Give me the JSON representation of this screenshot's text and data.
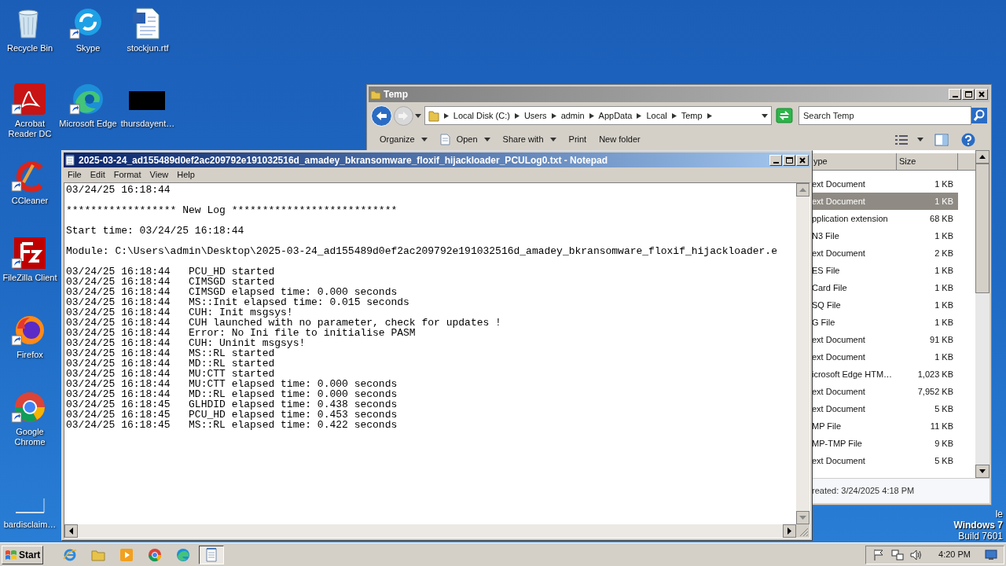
{
  "desktop_icons": [
    {
      "label": "Recycle Bin",
      "kind": "bin",
      "shortcut": false
    },
    {
      "label": "Skype",
      "kind": "skype",
      "shortcut": true
    },
    {
      "label": "stockjun.rtf",
      "kind": "doc",
      "shortcut": false
    },
    {
      "label": "Acrobat Reader DC",
      "kind": "acrobat",
      "shortcut": true
    },
    {
      "label": "Microsoft Edge",
      "kind": "edge",
      "shortcut": true
    },
    {
      "label": "thursdayent…",
      "kind": "blank_black",
      "shortcut": false
    },
    {
      "label": "CCleaner",
      "kind": "ccleaner",
      "shortcut": true
    },
    {
      "label": "FileZilla Client",
      "kind": "filezilla",
      "shortcut": true
    },
    {
      "label": "Firefox",
      "kind": "firefox",
      "shortcut": true
    },
    {
      "label": "Google Chrome",
      "kind": "chrome",
      "shortcut": true
    },
    {
      "label": "bardisclaim…",
      "kind": "blank_white",
      "shortcut": false
    }
  ],
  "os_branding": {
    "line_1": "le",
    "line_2": "Windows 7",
    "line_3": "Build 7601"
  },
  "explorer": {
    "title": "Temp",
    "breadcrumb": [
      "Local Disk (C:)",
      "Users",
      "admin",
      "AppData",
      "Local",
      "Temp"
    ],
    "search": {
      "placeholder": "Search Temp"
    },
    "toolbar": [
      {
        "label": "Organize",
        "dropdown": true,
        "kind": "text"
      },
      {
        "label": "Open",
        "dropdown": true,
        "kind": "open"
      },
      {
        "label": "Share with",
        "dropdown": true,
        "kind": "text"
      },
      {
        "label": "Print",
        "dropdown": false,
        "kind": "text"
      },
      {
        "label": "New folder",
        "dropdown": false,
        "kind": "text"
      }
    ],
    "columns": [
      "ype",
      "Size"
    ],
    "rows": [
      {
        "type": "ext Document",
        "size": "1 KB",
        "selected": false
      },
      {
        "type": "ext Document",
        "size": "1 KB",
        "selected": true
      },
      {
        "type": "pplication extension",
        "size": "68 KB",
        "selected": false
      },
      {
        "type": "N3 File",
        "size": "1 KB",
        "selected": false
      },
      {
        "type": "ext Document",
        "size": "2 KB",
        "selected": false
      },
      {
        "type": "ES File",
        "size": "1 KB",
        "selected": false
      },
      {
        "type": "Card File",
        "size": "1 KB",
        "selected": false
      },
      {
        "type": "SQ File",
        "size": "1 KB",
        "selected": false
      },
      {
        "type": "G File",
        "size": "1 KB",
        "selected": false
      },
      {
        "type": "ext Document",
        "size": "91 KB",
        "selected": false
      },
      {
        "type": "ext Document",
        "size": "1 KB",
        "selected": false
      },
      {
        "type": "icrosoft Edge HTM…",
        "size": "1,023 KB",
        "selected": false
      },
      {
        "type": "ext Document",
        "size": "7,952 KB",
        "selected": false
      },
      {
        "type": "ext Document",
        "size": "5 KB",
        "selected": false
      },
      {
        "type": "MP File",
        "size": "11 KB",
        "selected": false
      },
      {
        "type": "MP-TMP File",
        "size": "9 KB",
        "selected": false
      },
      {
        "type": "ext Document",
        "size": "5 KB",
        "selected": false
      }
    ],
    "details": "reated: 3/24/2025 4:18 PM"
  },
  "notepad": {
    "title": "2025-03-24_ad155489d0ef2ac209792e191032516d_amadey_bkransomware_floxif_hijackloader_PCULog0.txt - Notepad",
    "menu": [
      "File",
      "Edit",
      "Format",
      "View",
      "Help"
    ],
    "paragraphs": [
      [
        "03/24/25 16:18:44"
      ],
      [
        "****************** New Log ***************************"
      ],
      [
        "Start time: 03/24/25 16:18:44"
      ],
      [
        "Module: C:\\Users\\admin\\Desktop\\2025-03-24_ad155489d0ef2ac209792e191032516d_amadey_bkransomware_floxif_hijackloader.e"
      ],
      [
        "03/24/25 16:18:44   PCU_HD started",
        "03/24/25 16:18:44   CIMSGD started",
        "03/24/25 16:18:44   CIMSGD elapsed time: 0.000 seconds",
        "03/24/25 16:18:44   MS::Init elapsed time: 0.015 seconds",
        "03/24/25 16:18:44   CUH: Init msgsys!",
        "03/24/25 16:18:44   CUH launched with no parameter, check for updates !",
        "03/24/25 16:18:44   Error: No Ini file to initialise PASM",
        "03/24/25 16:18:44   CUH: Uninit msgsys!",
        "03/24/25 16:18:44   MS::RL started",
        "03/24/25 16:18:44   MD::RL started",
        "03/24/25 16:18:44   MU:CTT started",
        "03/24/25 16:18:44   MU:CTT elapsed time: 0.000 seconds",
        "03/24/25 16:18:44   MD::RL elapsed time: 0.000 seconds",
        "03/24/25 16:18:45   GLHDID elapsed time: 0.438 seconds",
        "03/24/25 16:18:45   PCU_HD elapsed time: 0.453 seconds",
        "03/24/25 16:18:45   MS::RL elapsed time: 0.422 seconds"
      ]
    ]
  },
  "taskbar": {
    "start": "Start",
    "apps": [
      {
        "kind": "ie",
        "active": false
      },
      {
        "kind": "explorer",
        "active": false
      },
      {
        "kind": "media",
        "active": false
      },
      {
        "kind": "chrome",
        "active": false
      },
      {
        "kind": "edge",
        "active": false
      },
      {
        "kind": "notepad",
        "active": true
      }
    ],
    "clock": "4:20 PM"
  }
}
